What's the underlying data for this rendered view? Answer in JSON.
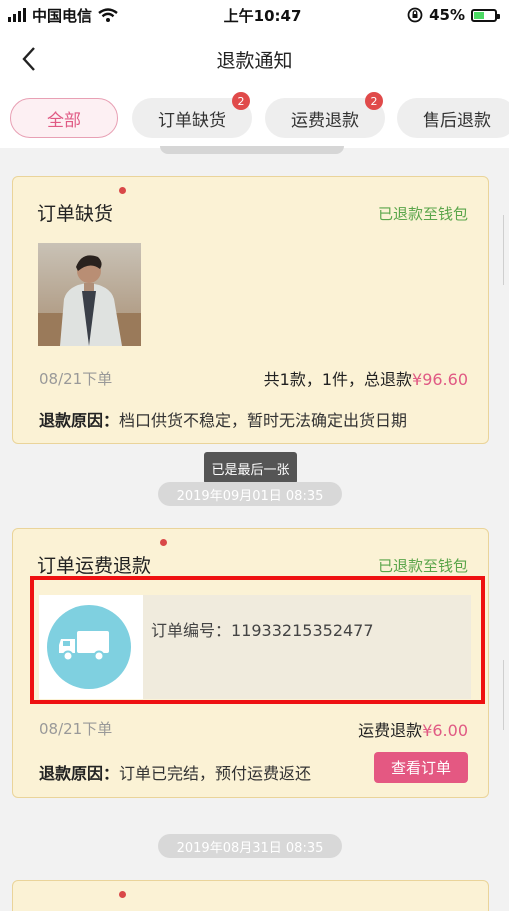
{
  "status_bar": {
    "carrier": "中国电信",
    "time": "上午10:47",
    "battery": "45%"
  },
  "nav": {
    "title": "退款通知"
  },
  "tabs": [
    {
      "label": "全部",
      "active": true
    },
    {
      "label": "订单缺货",
      "badge": "2"
    },
    {
      "label": "运费退款",
      "badge": "2"
    },
    {
      "label": "售后退款"
    }
  ],
  "cards": [
    {
      "title": "订单缺货",
      "status": "已退款至钱包",
      "date": "08/21下单",
      "summary_prefix": "共1款，1件，总退款",
      "amount": "¥96.60",
      "reason_label": "退款原因：",
      "reason": "档口供货不稳定，暂时无法确定出货日期"
    },
    {
      "title": "订单运费退款",
      "status": "已退款至钱包",
      "order_number_label": "订单编号：",
      "order_number": "11933215352477",
      "date": "08/21下单",
      "summary_prefix": "运费退款",
      "amount": "¥6.00",
      "reason_label": "退款原因：",
      "reason": "订单已完结，预付运费返还",
      "button": "查看订单"
    }
  ],
  "tooltip": "已是最后一张",
  "timestamps": [
    "2019年09月01日 08:35",
    "2019年08月31日 08:35"
  ],
  "colors": {
    "accent": "#e05a84",
    "card_bg": "#fbf2d5",
    "status_green": "#5aa54a",
    "highlight": "#ee1111"
  }
}
